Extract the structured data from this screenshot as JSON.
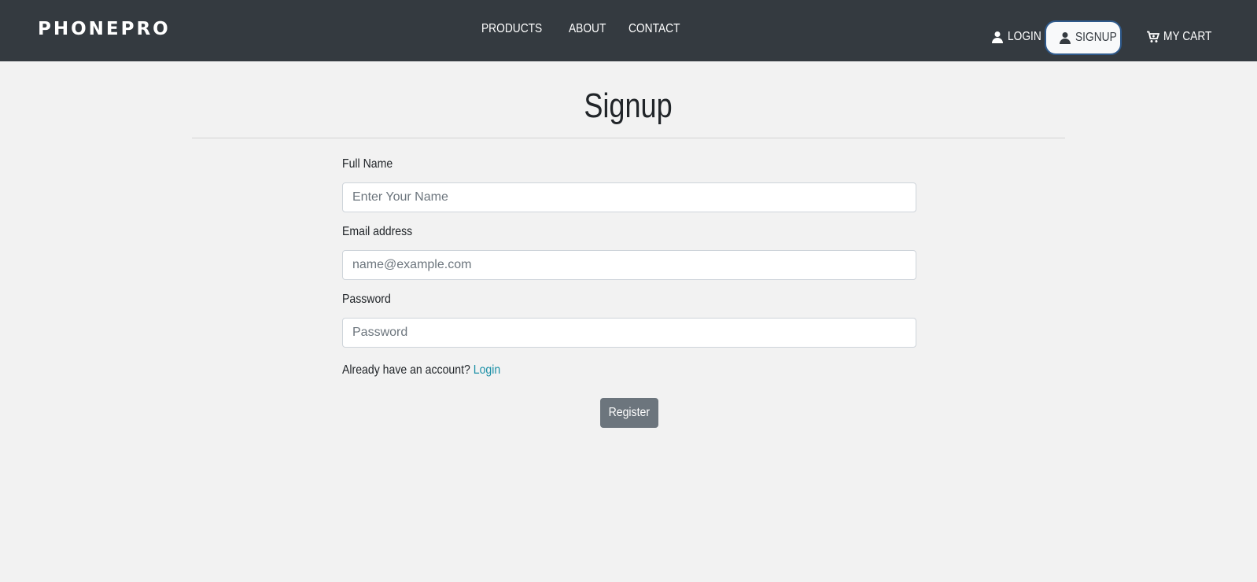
{
  "nav": {
    "brand": "PHONEPRO",
    "links": [
      "PRODUCTS",
      "ABOUT",
      "CONTACT"
    ],
    "login": "LOGIN",
    "signup": "SIGNUP",
    "cart": "MY CART"
  },
  "page": {
    "title": "Signup"
  },
  "form": {
    "name_label": "Full Name",
    "name_placeholder": "Enter Your Name",
    "email_label": "Email address",
    "email_placeholder": "name@example.com",
    "password_label": "Password",
    "password_placeholder": "Password",
    "already_text": "Already have an account?",
    "login_link": "Login",
    "register_label": "Register"
  },
  "colors": {
    "navbar": "#343a40",
    "background": "#f2f2f2",
    "link": "#1b8fa6",
    "button": "#6c757d",
    "signup_border": "#2f5a8c"
  },
  "icons": {
    "login": "user-icon",
    "signup": "user-icon",
    "cart": "cart-icon"
  }
}
